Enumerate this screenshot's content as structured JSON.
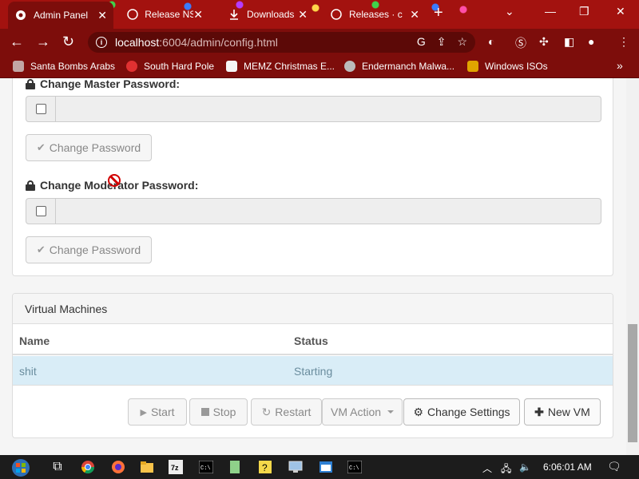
{
  "browser": {
    "tabs": [
      {
        "title": "Admin Panel",
        "icon": "chrome-icon",
        "active": true
      },
      {
        "title": "Release NS",
        "icon": "github-icon",
        "active": false
      },
      {
        "title": "Downloads",
        "icon": "download-icon",
        "active": false
      },
      {
        "title": "Releases · c",
        "icon": "github-icon",
        "active": false
      }
    ],
    "new_tab": "+",
    "address": {
      "host": "localhost",
      "path": ":6004/admin/config.html"
    },
    "bookmarks": [
      {
        "label": "Santa Bombs Arabs"
      },
      {
        "label": "South Hard Pole"
      },
      {
        "label": "MEMZ Christmas E..."
      },
      {
        "label": "Endermanch Malwa..."
      },
      {
        "label": "Windows ISOs"
      }
    ],
    "bookmarks_more": "»"
  },
  "page": {
    "master_password": {
      "label": "Change Master Password:",
      "value": "",
      "button": "Change Password"
    },
    "moderator_password": {
      "label": "Change Moderator Password:",
      "value": "",
      "button": "Change Password"
    },
    "vm_panel": {
      "heading": "Virtual Machines",
      "columns": [
        "Name",
        "Status"
      ],
      "rows": [
        {
          "name": "shit",
          "status": "Starting"
        }
      ],
      "buttons": {
        "start": "Start",
        "stop": "Stop",
        "restart": "Restart",
        "vm_action": "VM Action",
        "change_settings": "Change Settings",
        "new_vm": "New VM"
      }
    }
  },
  "taskbar": {
    "time": "6:06:01 AM"
  },
  "colors": {
    "chrome_frame": "#7d0d0b",
    "selected_row": "#d9edf7",
    "disabled_text": "#888888"
  }
}
